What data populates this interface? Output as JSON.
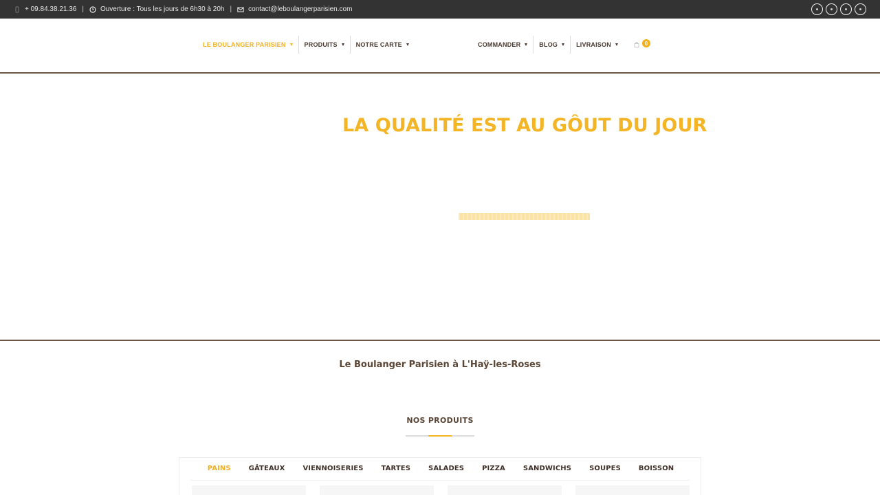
{
  "topbar": {
    "phone": "+ 09.84.38.21.36",
    "hours": "Ouverture : Tous les jours de 6h30 à 20h",
    "email": "contact@leboulangerparisien.com",
    "separator": "|",
    "social_icons": [
      "facebook-icon",
      "instagram-icon",
      "google-icon",
      "tripadvisor-icon"
    ]
  },
  "nav": {
    "left_items": [
      {
        "label": "LE BOULANGER PARISIEN",
        "active": true
      },
      {
        "label": "PRODUITS"
      },
      {
        "label": "NOTRE CARTE"
      }
    ],
    "right_items": [
      {
        "label": "COMMANDER"
      },
      {
        "label": "BLOG"
      },
      {
        "label": "LIVRAISON"
      }
    ],
    "cart_count": "0"
  },
  "hero": {
    "title": "LA QUALITÉ EST AU GÔUT DU JOUR"
  },
  "intro": {
    "heading": "Le Boulanger Parisien à L'Haÿ-les-Roses"
  },
  "products": {
    "title": "NOS PRODUITS",
    "tabs": [
      "PAINS",
      "GÂTEAUX",
      "VIENNOISERIES",
      "TARTES",
      "SALADES",
      "PIZZA",
      "SANDWICHS",
      "SOUPES",
      "BOISSON"
    ]
  },
  "colors": {
    "accent": "#f3b526",
    "brown": "#5b4636",
    "topbar": "#333333"
  }
}
